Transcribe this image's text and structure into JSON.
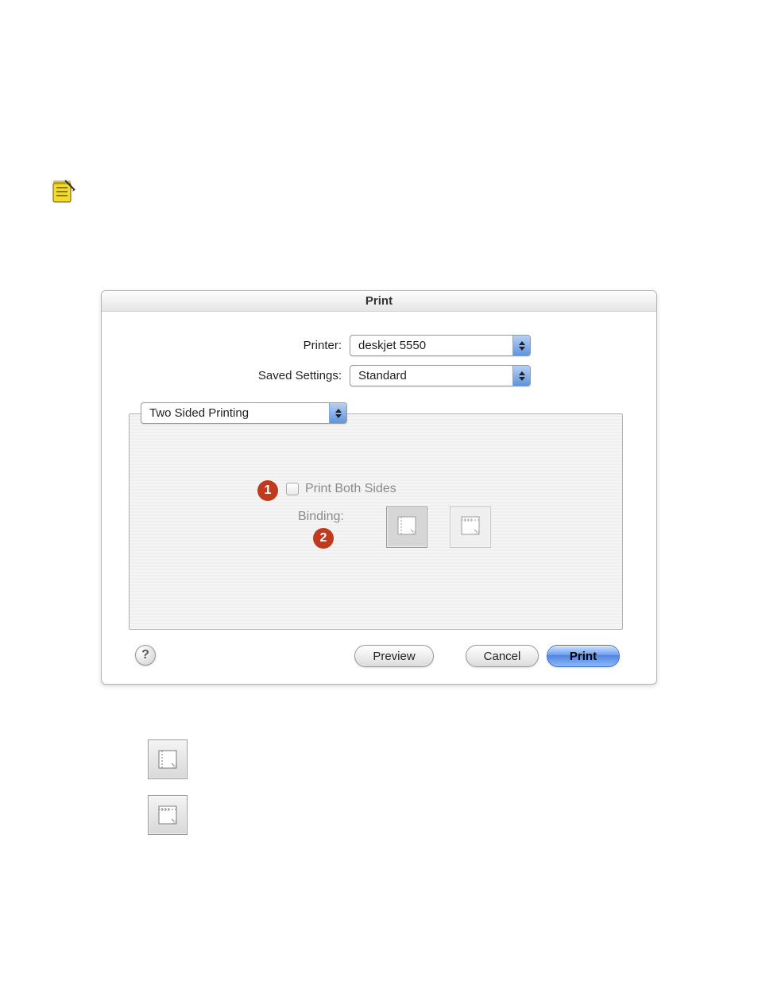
{
  "top_link_text": " ",
  "dialog": {
    "title": "Print",
    "printer_label": "Printer:",
    "printer_value": "deskjet 5550",
    "settings_label": "Saved Settings:",
    "settings_value": "Standard",
    "panel_value": "Two Sided Printing",
    "checkbox_label": "Print Both Sides",
    "binding_label": "Binding:",
    "marker1": "1",
    "marker2": "2",
    "help_glyph": "?",
    "buttons": {
      "preview": "Preview",
      "cancel": "Cancel",
      "print": "Print"
    }
  }
}
